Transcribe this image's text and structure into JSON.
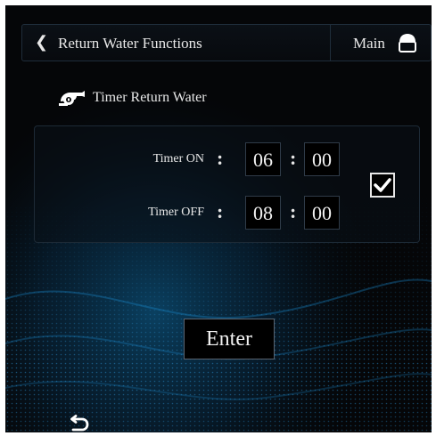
{
  "header": {
    "back_icon": "chevron-left-icon",
    "title": "Return Water Functions",
    "main_label": "Main",
    "home_icon": "home-icon"
  },
  "section": {
    "icon": "faucet-icon",
    "title": "Timer Return Water"
  },
  "timer_on": {
    "label": "Timer ON",
    "colon": ":",
    "hour": "06",
    "separator": ":",
    "minute": "00"
  },
  "timer_off": {
    "label": "Timer OFF",
    "colon": ":",
    "hour": "08",
    "separator": ":",
    "minute": "00"
  },
  "enabled_checkbox": {
    "checked": true,
    "icon": "checkmark-icon"
  },
  "enter_label": "Enter",
  "footer": {
    "back_icon": "return-arrow-icon"
  },
  "colors": {
    "background": "#050608",
    "text": "#e8e8e8",
    "wave_accent": "#0f7db8"
  }
}
